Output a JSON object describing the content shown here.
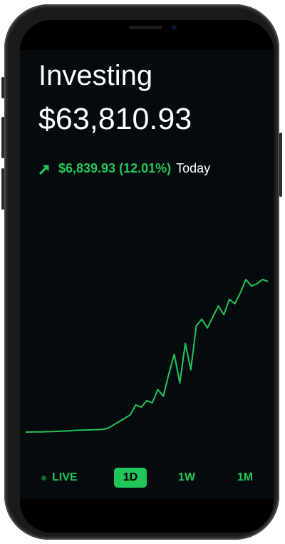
{
  "app": {
    "title": "Investing",
    "balance": "$63,810.93",
    "change": "$6,839.93 (12.01%)",
    "change_period": "Today",
    "accent_color": "#21c65a",
    "background_color": "#050a0e",
    "trend_icon": "arrow-up-right-icon"
  },
  "ranges": [
    {
      "label": "LIVE",
      "selected": false
    },
    {
      "label": "1D",
      "selected": true
    },
    {
      "label": "1W",
      "selected": false
    },
    {
      "label": "1M",
      "selected": false
    }
  ],
  "chart_data": {
    "type": "line",
    "title": "",
    "xlabel": "",
    "ylabel": "",
    "grid": false,
    "y": [
      56971,
      56975,
      56978,
      56980,
      56990,
      56995,
      57005,
      57015,
      57030,
      57050,
      57060,
      57065,
      57070,
      57080,
      57090,
      57150,
      57300,
      57450,
      57600,
      57750,
      58200,
      58100,
      58400,
      58300,
      58900,
      58600,
      59600,
      60500,
      59200,
      61000,
      59800,
      61800,
      62100,
      61700,
      62200,
      62700,
      62300,
      63000,
      62800,
      63300,
      63900,
      63600,
      63700,
      63900,
      63811
    ]
  }
}
